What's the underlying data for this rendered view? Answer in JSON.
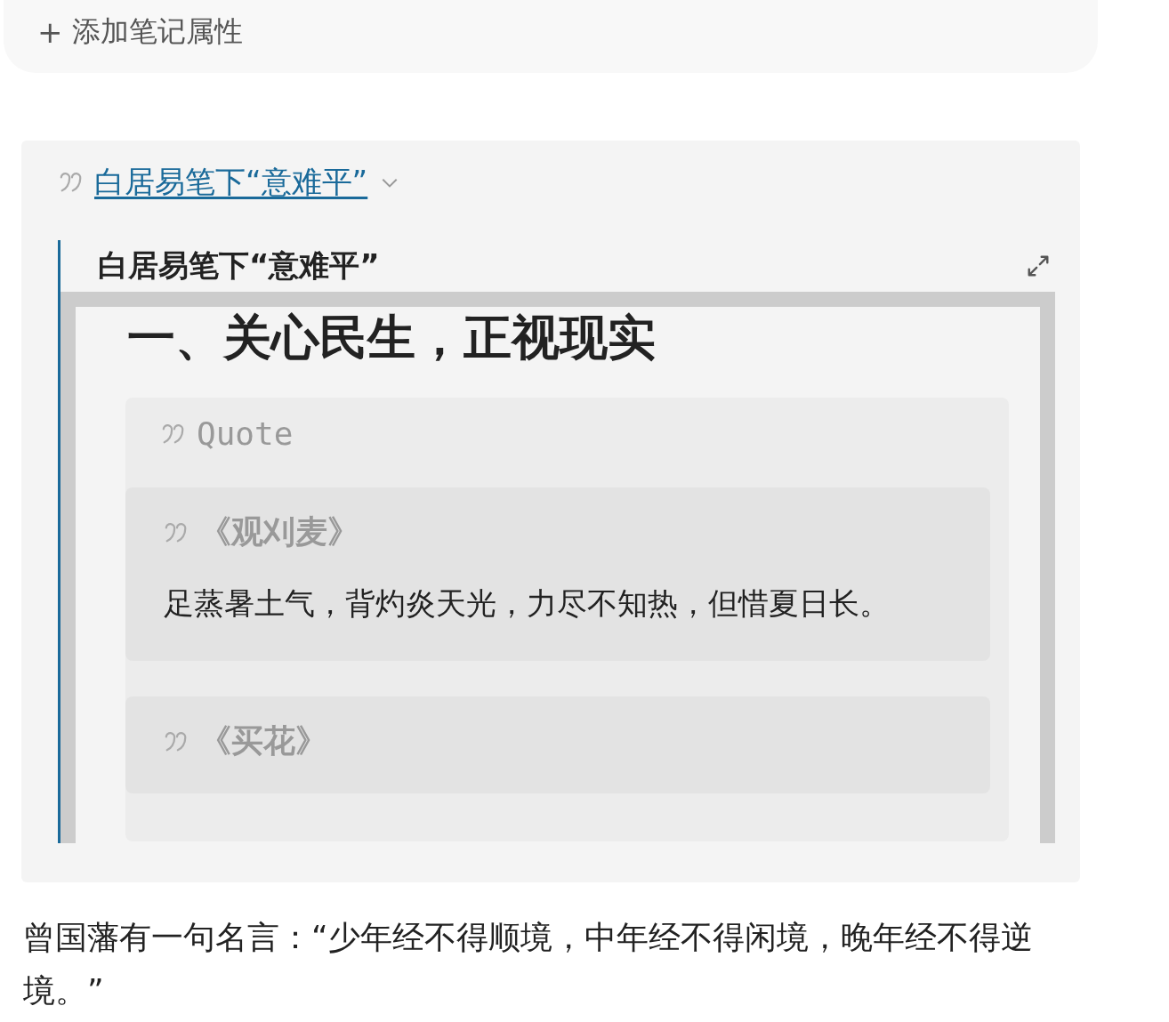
{
  "property_button": {
    "icon": "+",
    "label": "添加笔记属性"
  },
  "embed": {
    "link": "白居易笔下“意难平”",
    "title": "白居易笔下“意难平”",
    "content": [
      {
        "kind": "heading",
        "text": "一、关心民生，正视现实"
      },
      {
        "kind": "callout",
        "title": "Quote",
        "children": [
          {
            "kind": "callout",
            "title": "《观刈麦》",
            "body": "足蒸暑土气，背灼炎天光，力尽不知热，但惜夏日长。"
          },
          {
            "kind": "callout",
            "title": "《买花》"
          }
        ]
      }
    ]
  },
  "paragraph": "曾国藩有一句名言：“少年经不得顺境，中年经不得闲境，晚年经不得逆境。”"
}
